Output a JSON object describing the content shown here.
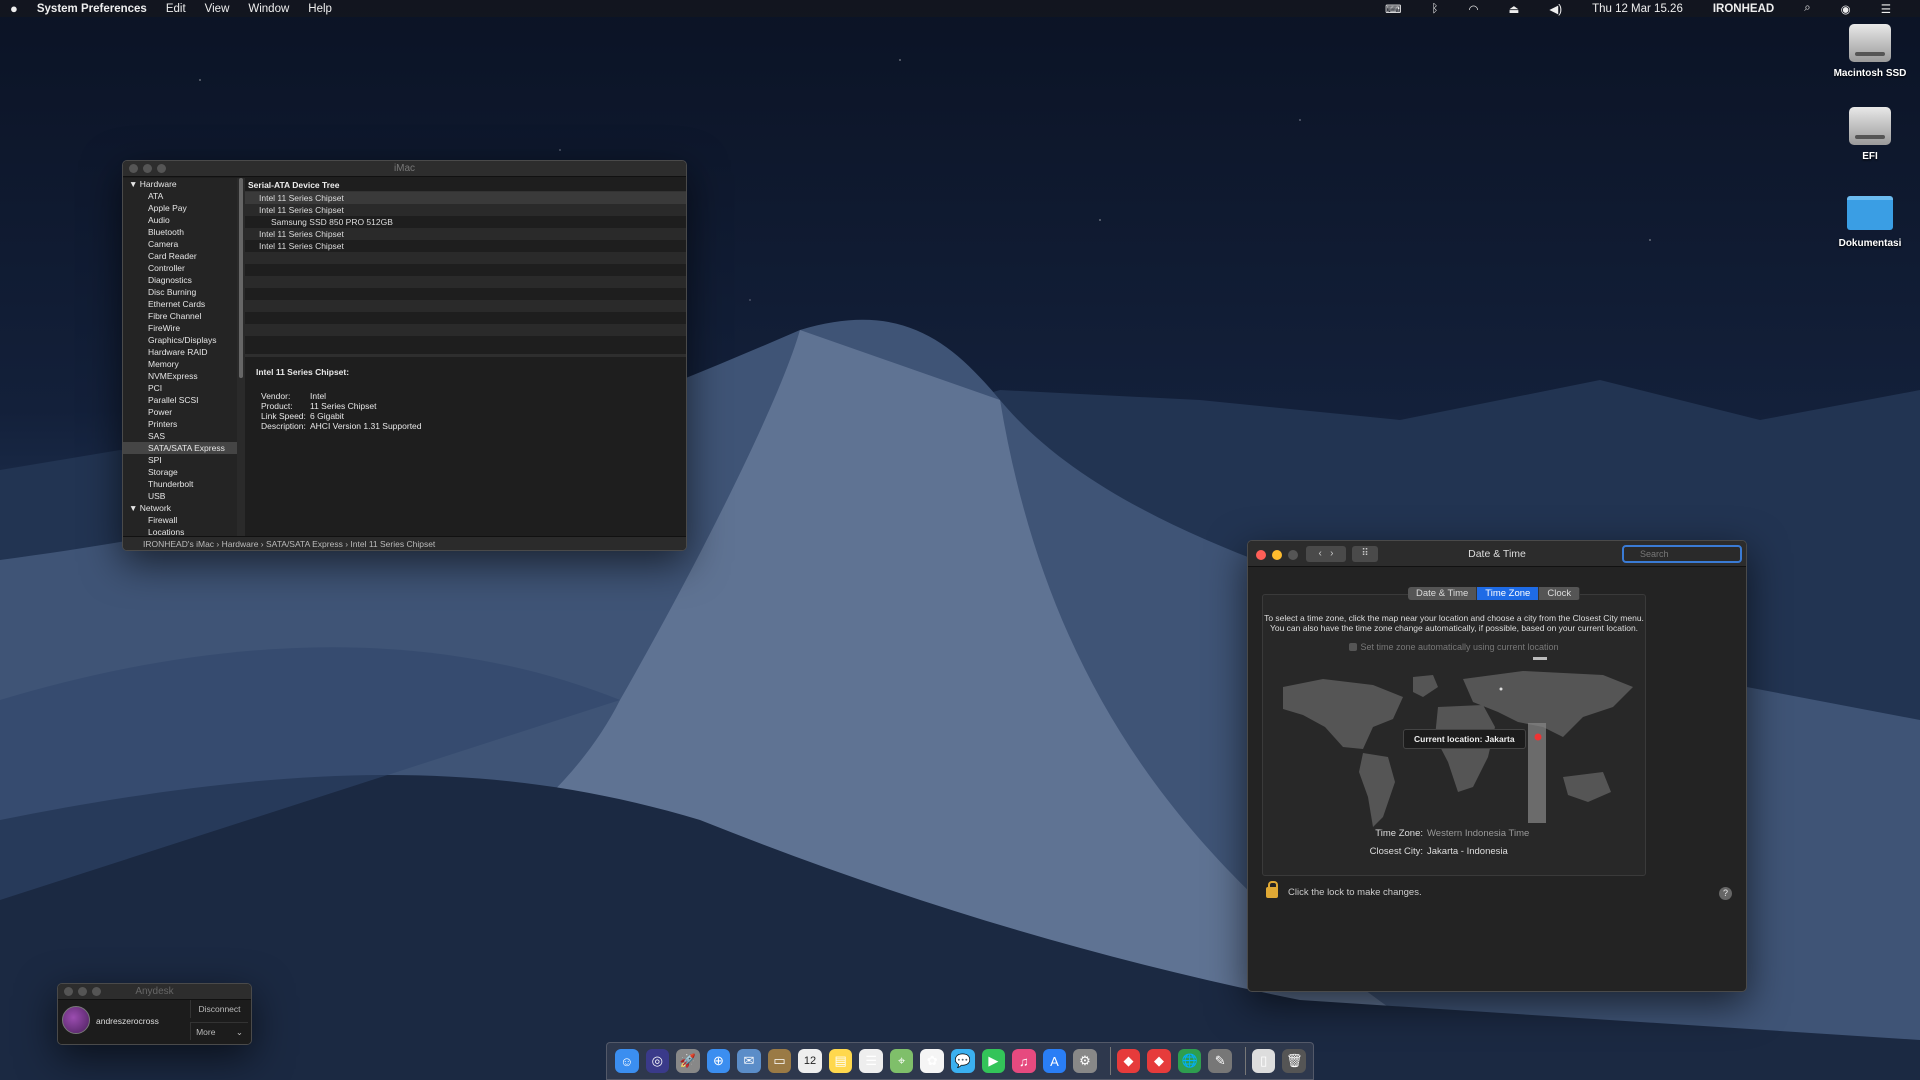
{
  "menubar": {
    "apple": "",
    "app": "System Preferences",
    "items": [
      "Edit",
      "View",
      "Window",
      "Help"
    ],
    "status_icons": [
      "keyboard-input-icon",
      "bluetooth-icon",
      "wifi-icon",
      "eject-icon",
      "volume-icon"
    ],
    "clock": "Thu 12 Mar  15.26",
    "user": "IRONHEAD"
  },
  "desktop": {
    "icons": [
      {
        "label": "Macintosh SSD",
        "icon": "hard-disk-icon"
      },
      {
        "label": "EFI",
        "icon": "hard-disk-icon"
      },
      {
        "label": "Dokumentasi",
        "icon": "folder-icon"
      }
    ]
  },
  "sysinfo": {
    "title": "iMac",
    "sidebar": [
      {
        "label": "Hardware",
        "group": true
      },
      {
        "label": "ATA"
      },
      {
        "label": "Apple Pay"
      },
      {
        "label": "Audio"
      },
      {
        "label": "Bluetooth"
      },
      {
        "label": "Camera"
      },
      {
        "label": "Card Reader"
      },
      {
        "label": "Controller"
      },
      {
        "label": "Diagnostics"
      },
      {
        "label": "Disc Burning"
      },
      {
        "label": "Ethernet Cards"
      },
      {
        "label": "Fibre Channel"
      },
      {
        "label": "FireWire"
      },
      {
        "label": "Graphics/Displays"
      },
      {
        "label": "Hardware RAID"
      },
      {
        "label": "Memory"
      },
      {
        "label": "NVMExpress"
      },
      {
        "label": "PCI"
      },
      {
        "label": "Parallel SCSI"
      },
      {
        "label": "Power"
      },
      {
        "label": "Printers"
      },
      {
        "label": "SAS"
      },
      {
        "label": "SATA/SATA Express",
        "selected": true
      },
      {
        "label": "SPI"
      },
      {
        "label": "Storage"
      },
      {
        "label": "Thunderbolt"
      },
      {
        "label": "USB"
      },
      {
        "label": "Network",
        "group": true
      },
      {
        "label": "Firewall"
      },
      {
        "label": "Locations"
      }
    ],
    "tree_header": "Serial-ATA Device Tree",
    "tree_rows": [
      {
        "label": "Intel 11 Series Chipset",
        "indent": 1
      },
      {
        "label": "Intel 11 Series Chipset",
        "indent": 1,
        "expanded": true
      },
      {
        "label": "Samsung SSD 850 PRO 512GB",
        "indent": 2
      },
      {
        "label": "Intel 11 Series Chipset",
        "indent": 1
      },
      {
        "label": "Intel 11 Series Chipset",
        "indent": 1
      }
    ],
    "detail_title": "Intel 11 Series Chipset:",
    "detail": [
      {
        "k": "Vendor:",
        "v": "Intel"
      },
      {
        "k": "Product:",
        "v": "11 Series Chipset"
      },
      {
        "k": "Link Speed:",
        "v": "6 Gigabit"
      },
      {
        "k": "Description:",
        "v": "AHCI Version 1.31 Supported"
      }
    ],
    "path": "IRONHEAD's iMac  ›  Hardware  ›  SATA/SATA Express  ›  Intel 11 Series Chipset"
  },
  "datetime": {
    "title": "Date & Time",
    "search_placeholder": "Search",
    "tabs": [
      "Date & Time",
      "Time Zone",
      "Clock"
    ],
    "active_tab": 1,
    "info1": "To select a time zone, click the map near your location and choose a city from the Closest City menu.",
    "info2": "You can also have the time zone change automatically, if possible, based on your current location.",
    "auto_label": "Set time zone automatically using current location",
    "current_location": "Current location: Jakarta",
    "tz_label": "Time Zone:",
    "tz_value": "Western Indonesia Time",
    "city_label": "Closest City:",
    "city_value": "Jakarta - Indonesia",
    "lock_text": "Click the lock to make changes.",
    "help": "?"
  },
  "anydesk": {
    "title": "Anydesk",
    "user": "andreszerocross",
    "disconnect": "Disconnect",
    "more": "More"
  },
  "dock": {
    "apps": [
      "finder-icon",
      "siri-icon",
      "launchpad-icon",
      "safari-icon",
      "mail-icon",
      "notes-app-icon",
      "calendar-icon",
      "stickies-icon",
      "reminders-icon",
      "maps-icon",
      "photos-icon",
      "messages-icon",
      "facetime-icon",
      "itunes-icon",
      "app-store-icon",
      "system-preferences-icon",
      "anydesk-icon",
      "anydesk-icon-2",
      "world-icon",
      "script-editor-icon",
      "document-icon",
      "trash-icon"
    ],
    "calendar_day": "12"
  }
}
